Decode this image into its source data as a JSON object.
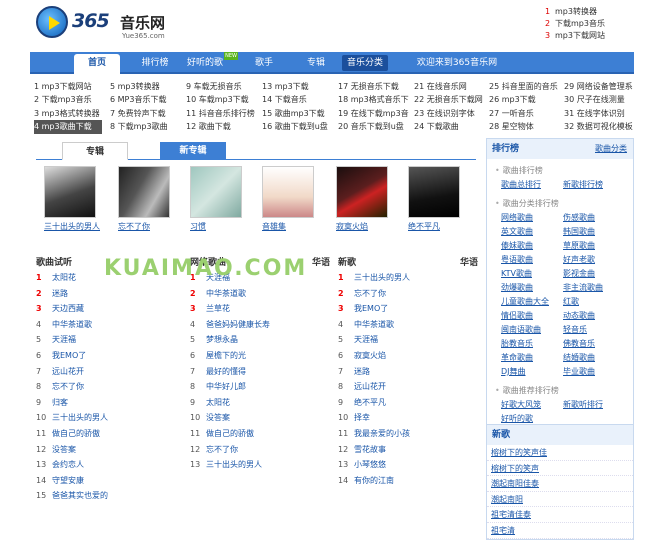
{
  "logo": {
    "brand": "365",
    "cn": "音乐网",
    "url": "Yue365.com"
  },
  "top_links": [
    {
      "num": "1",
      "label": "mp3转换器"
    },
    {
      "num": "2",
      "label": "下载mp3音乐"
    },
    {
      "num": "3",
      "label": "mp3下载网站"
    }
  ],
  "nav": {
    "items": [
      "首页",
      "排行榜",
      "好听的歌",
      "歌手",
      "专辑",
      "音乐分类",
      "欢迎来到365音乐网"
    ],
    "new_badge": "NEW"
  },
  "link_grid": [
    [
      "1 mp3下载网站",
      "2 下载mp3音乐",
      "3 mp3格式转换器",
      "4 mp3歌曲下载"
    ],
    [
      "5 mp3转换器",
      "6 MP3音乐下载",
      "7 免费铃声下载",
      "8 下载mp3歌曲"
    ],
    [
      "9 车载无损音乐",
      "10 车载mp3下载",
      "11 抖音音乐排行榜",
      "12 歌曲下载"
    ],
    [
      "13 mp3下载",
      "14 下载音乐",
      "15 歌曲mp3下载",
      "16 歌曲下载到u盘"
    ],
    [
      "17 无损音乐下载",
      "18 mp3格式音乐下",
      "19 在线下载mp3音",
      "20 音乐下载到u盘"
    ],
    [
      "21 在线音乐网",
      "22 无损音乐下载网",
      "23 在线识别字体",
      "24 下载歌曲"
    ],
    [
      "25 抖音里面的音乐",
      "26 mp3下载",
      "27 一听音乐",
      "28 星空物体"
    ],
    [
      "29 网络设备管理系",
      "30 尺子在线测量",
      "31 在线字体识别",
      "32 数据可视化模板"
    ]
  ],
  "album_tabs": {
    "tab1": "专辑",
    "tab2": "新专辑"
  },
  "albums": [
    "三十出头的男人",
    "忘不了你",
    "习惯",
    "音雄集",
    "寂寞火焰",
    "绝不平凡"
  ],
  "lists": {
    "trial": {
      "title": "歌曲试听",
      "items": [
        "太阳花",
        "迷路",
        "天边西藏",
        "中华茶道歌",
        "天涯福",
        "我EMO了",
        "远山花开",
        "忘不了你",
        "归客",
        "三十出头的男人",
        "做自己的骄傲",
        "没答案",
        "会约恋人",
        "守望安康",
        "爸爸其实也爱的"
      ]
    },
    "web": {
      "title": "网络歌曲",
      "tag": "华语",
      "items": [
        "天涯福",
        "中华茶道歌",
        "兰草花",
        "爸爸妈妈健康长寿",
        "梦想永晶",
        "屋檐下的光",
        "最好的懂得",
        "中华好儿郎",
        "太阳花",
        "没答案",
        "做自己的骄傲",
        "忘不了你",
        "三十出头的男人"
      ]
    },
    "new": {
      "title": "新歌",
      "tag": "华语",
      "items": [
        "三十出头的男人",
        "忘不了你",
        "我EMO了",
        "中华茶道歌",
        "天涯福",
        "寂寞火焰",
        "迷路",
        "远山花开",
        "绝不平凡",
        "择幸",
        "我最亲爱的小孩",
        "雪花故事",
        "小琴悠悠",
        "有你的江南"
      ]
    }
  },
  "watermark": "KUAIMAO.COM",
  "sidebar": {
    "title": "排行榜",
    "more": "歌曲分类",
    "sec1": "歌曲排行榜",
    "sec1_items": [
      [
        "歌曲总排行",
        "新歌排行榜"
      ]
    ],
    "sec2": "歌曲分类排行榜",
    "sec2_items": [
      [
        "网络歌曲",
        "伤感歌曲"
      ],
      [
        "英文歌曲",
        "韩国歌曲"
      ],
      [
        "傣妹歌曲",
        "草原歌曲"
      ],
      [
        "粤语歌曲",
        "好声老歌"
      ],
      [
        "KTV歌曲",
        "影视金曲"
      ],
      [
        "劲爆歌曲",
        "非主流歌曲"
      ],
      [
        "儿童歌曲大全",
        "红歌"
      ],
      [
        "情侣歌曲",
        "动态歌曲"
      ],
      [
        "闽南语歌曲",
        "轻音乐"
      ],
      [
        "胎教音乐",
        "佛教音乐"
      ],
      [
        "革命歌曲",
        "结婚歌曲"
      ],
      [
        "DJ舞曲",
        "毕业歌曲"
      ]
    ],
    "sec3": "歌曲推荐排行榜",
    "sec3_items": [
      [
        "好歌大风笼",
        "新歌听排行"
      ],
      [
        "好听的歌",
        ""
      ]
    ]
  },
  "new_songs": {
    "title": "新歌",
    "items": [
      "榕树下的笑声佳",
      "榕树下的笑声",
      "潮起南阳佳泰",
      "潮起南阳",
      "祖宅清佳泰",
      "祖宅清"
    ]
  },
  "colors": {
    "nav_blue": "#3d7fd4",
    "link_blue": "#1a56a8",
    "rank_red": "#e00"
  }
}
